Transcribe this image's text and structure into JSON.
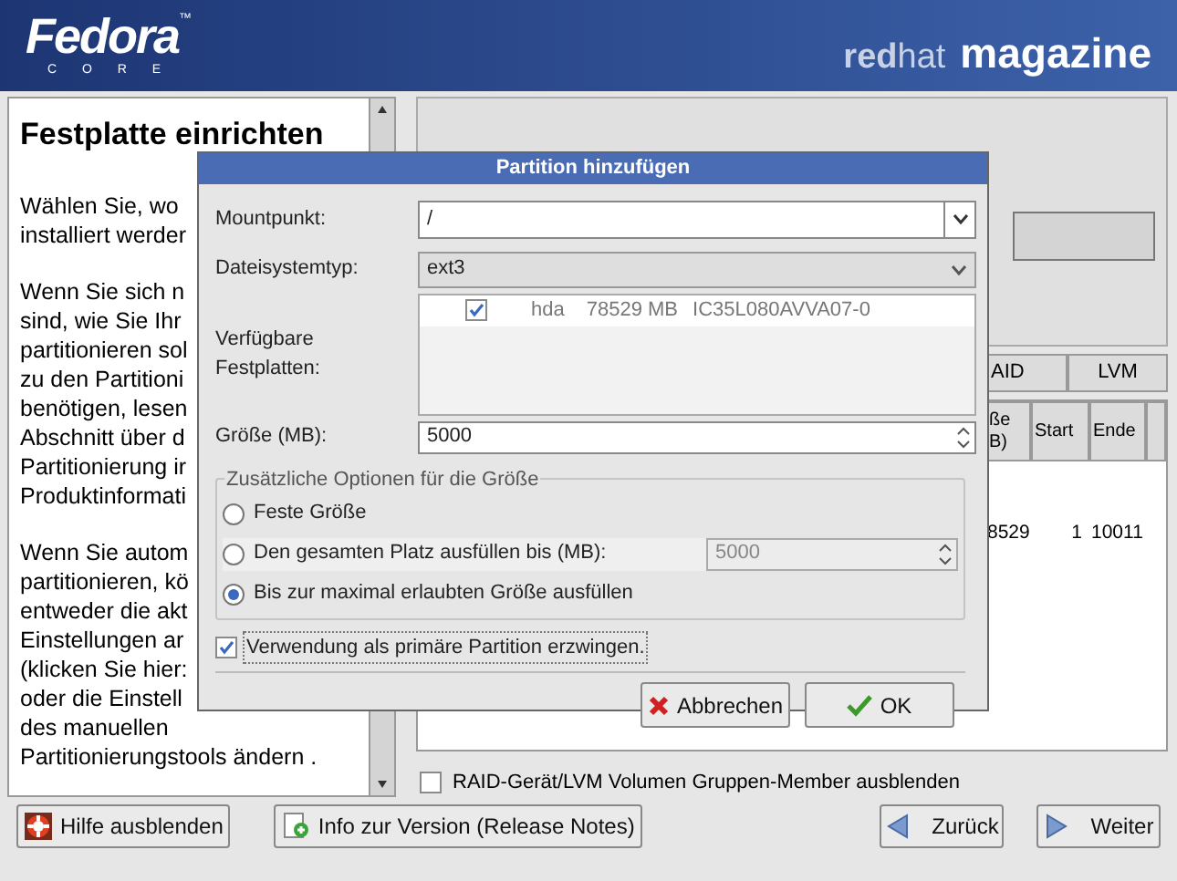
{
  "header": {
    "logo": "Fedora",
    "logo_mark": "™",
    "logo_sub": "C O R E",
    "brand_prefix": "**red**hat",
    "brand": "magazine"
  },
  "help": {
    "title": "Festplatte einrichten",
    "paragraphs": [
      [
        "Wählen Sie, wo",
        "installiert werder"
      ],
      [
        "Wenn Sie sich n",
        "sind, wie Sie Ihr",
        "partitionieren sol",
        "zu den Partitioni",
        "benötigen, lesen",
        "Abschnitt über d",
        "Partitionierung ir",
        "Produktinformati"
      ],
      [
        "Wenn Sie autom",
        "partitionieren, kö",
        "entweder die akt",
        "Einstellungen ar",
        "(klicken Sie hier:",
        "oder die Einstell",
        "des manuellen",
        "Partitionierungstools ändern ."
      ]
    ]
  },
  "tabs": [
    {
      "label": "AID",
      "selected": false
    },
    {
      "label": "LVM",
      "selected": false
    }
  ],
  "table": {
    "columns": [
      "ße\nB)",
      "Start",
      "Ende"
    ],
    "rows": [
      [
        "8529",
        "1",
        "10011"
      ]
    ]
  },
  "hide_members": {
    "label": "RAID-Gerät/LVM Volumen Gruppen-Member ausblenden",
    "checked": false
  },
  "dialog": {
    "title": "Partition hinzufügen",
    "mountpoint": {
      "label": "Mountpunkt:",
      "value": "/"
    },
    "fstype": {
      "label": "Dateisystemtyp:",
      "value": "ext3"
    },
    "disks": {
      "label": "Verfügbare Festplatten:",
      "rows": [
        {
          "checked": true,
          "name": "hda",
          "size": "78529 MB",
          "model": "IC35L080AVVA07-0"
        }
      ]
    },
    "size": {
      "label": "Größe (MB):",
      "value": "5000"
    },
    "options": {
      "legend": "Zusätzliche Optionen für die Größe",
      "items": [
        {
          "label": "Feste Größe",
          "selected": false
        },
        {
          "label": "Den gesamten Platz ausfüllen bis (MB):",
          "selected": false,
          "value": "5000"
        },
        {
          "label": "Bis zur maximal erlaubten Größe ausfüllen",
          "selected": true
        }
      ]
    },
    "primary": {
      "label": "Verwendung als primäre Partition erzwingen.",
      "checked": true
    },
    "buttons": [
      {
        "label": "Abbrechen",
        "kind": "cancel"
      },
      {
        "label": "OK",
        "kind": "ok"
      }
    ]
  },
  "footer": {
    "left": [
      {
        "label": "Hilfe ausblenden",
        "kind": "help"
      },
      {
        "label": "Info zur Version (Release Notes)",
        "kind": "info"
      }
    ],
    "right": [
      {
        "label": "Zurück",
        "kind": "back"
      },
      {
        "label": "Weiter",
        "kind": "next"
      }
    ]
  }
}
